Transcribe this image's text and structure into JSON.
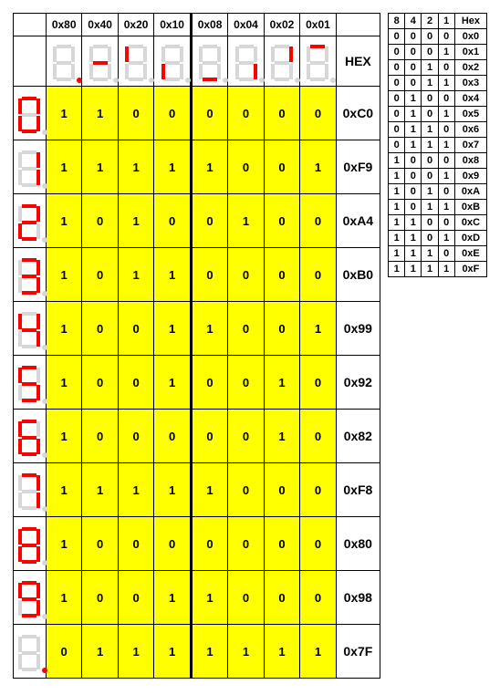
{
  "main": {
    "col_headers": [
      "0x80",
      "0x40",
      "0x20",
      "0x10",
      "0x08",
      "0x04",
      "0x02",
      "0x01"
    ],
    "hex_label": "HEX",
    "seg_order": [
      "dp",
      "g",
      "f",
      "e",
      "d",
      "c",
      "b",
      "a"
    ],
    "header_icons": [
      [
        "dp"
      ],
      [
        "g"
      ],
      [
        "f"
      ],
      [
        "e"
      ],
      [
        "d"
      ],
      [
        "c"
      ],
      [
        "b"
      ],
      [
        "a"
      ]
    ],
    "rows": [
      {
        "icon": [
          "a",
          "b",
          "c",
          "d",
          "e",
          "f"
        ],
        "bits": [
          "1",
          "1",
          "0",
          "0",
          "0",
          "0",
          "0",
          "0"
        ],
        "hex": "0xC0"
      },
      {
        "icon": [
          "b",
          "c"
        ],
        "bits": [
          "1",
          "1",
          "1",
          "1",
          "1",
          "0",
          "0",
          "1"
        ],
        "hex": "0xF9"
      },
      {
        "icon": [
          "a",
          "b",
          "d",
          "e",
          "g"
        ],
        "bits": [
          "1",
          "0",
          "1",
          "0",
          "0",
          "1",
          "0",
          "0"
        ],
        "hex": "0xA4"
      },
      {
        "icon": [
          "a",
          "b",
          "c",
          "d",
          "g"
        ],
        "bits": [
          "1",
          "0",
          "1",
          "1",
          "0",
          "0",
          "0",
          "0"
        ],
        "hex": "0xB0"
      },
      {
        "icon": [
          "b",
          "c",
          "f",
          "g"
        ],
        "bits": [
          "1",
          "0",
          "0",
          "1",
          "1",
          "0",
          "0",
          "1"
        ],
        "hex": "0x99"
      },
      {
        "icon": [
          "a",
          "c",
          "d",
          "f",
          "g"
        ],
        "bits": [
          "1",
          "0",
          "0",
          "1",
          "0",
          "0",
          "1",
          "0"
        ],
        "hex": "0x92"
      },
      {
        "icon": [
          "a",
          "c",
          "d",
          "e",
          "f",
          "g"
        ],
        "bits": [
          "1",
          "0",
          "0",
          "0",
          "0",
          "0",
          "1",
          "0"
        ],
        "hex": "0x82"
      },
      {
        "icon": [
          "a",
          "b",
          "c"
        ],
        "bits": [
          "1",
          "1",
          "1",
          "1",
          "1",
          "0",
          "0",
          "0"
        ],
        "hex": "0xF8"
      },
      {
        "icon": [
          "a",
          "b",
          "c",
          "d",
          "e",
          "f",
          "g"
        ],
        "bits": [
          "1",
          "0",
          "0",
          "0",
          "0",
          "0",
          "0",
          "0"
        ],
        "hex": "0x80"
      },
      {
        "icon": [
          "a",
          "b",
          "c",
          "d",
          "f",
          "g"
        ],
        "bits": [
          "1",
          "0",
          "0",
          "1",
          "1",
          "0",
          "0",
          "0"
        ],
        "hex": "0x98"
      },
      {
        "icon": [
          "dp"
        ],
        "bits": [
          "0",
          "1",
          "1",
          "1",
          "1",
          "1",
          "1",
          "1"
        ],
        "hex": "0x7F"
      }
    ]
  },
  "side": {
    "headers": [
      "8",
      "4",
      "2",
      "1",
      "Hex"
    ],
    "rows": [
      [
        "0",
        "0",
        "0",
        "0",
        "0x0"
      ],
      [
        "0",
        "0",
        "0",
        "1",
        "0x1"
      ],
      [
        "0",
        "0",
        "1",
        "0",
        "0x2"
      ],
      [
        "0",
        "0",
        "1",
        "1",
        "0x3"
      ],
      [
        "0",
        "1",
        "0",
        "0",
        "0x4"
      ],
      [
        "0",
        "1",
        "0",
        "1",
        "0x5"
      ],
      [
        "0",
        "1",
        "1",
        "0",
        "0x6"
      ],
      [
        "0",
        "1",
        "1",
        "1",
        "0x7"
      ],
      [
        "1",
        "0",
        "0",
        "0",
        "0x8"
      ],
      [
        "1",
        "0",
        "0",
        "1",
        "0x9"
      ],
      [
        "1",
        "0",
        "1",
        "0",
        "0xA"
      ],
      [
        "1",
        "0",
        "1",
        "1",
        "0xB"
      ],
      [
        "1",
        "1",
        "0",
        "0",
        "0xC"
      ],
      [
        "1",
        "1",
        "0",
        "1",
        "0xD"
      ],
      [
        "1",
        "1",
        "1",
        "0",
        "0xE"
      ],
      [
        "1",
        "1",
        "1",
        "1",
        "0xF"
      ]
    ]
  },
  "chart_data": {
    "type": "table",
    "title": "7-segment common-anode hex encoding",
    "columns": [
      "dp(0x80)",
      "g(0x40)",
      "f(0x20)",
      "e(0x10)",
      "d(0x08)",
      "c(0x04)",
      "b(0x02)",
      "a(0x01)",
      "HEX"
    ],
    "rows": [
      [
        "1",
        "1",
        "0",
        "0",
        "0",
        "0",
        "0",
        "0",
        "0xC0"
      ],
      [
        "1",
        "1",
        "1",
        "1",
        "1",
        "0",
        "0",
        "1",
        "0xF9"
      ],
      [
        "1",
        "0",
        "1",
        "0",
        "0",
        "1",
        "0",
        "0",
        "0xA4"
      ],
      [
        "1",
        "0",
        "1",
        "1",
        "0",
        "0",
        "0",
        "0",
        "0xB0"
      ],
      [
        "1",
        "0",
        "0",
        "1",
        "1",
        "0",
        "0",
        "1",
        "0x99"
      ],
      [
        "1",
        "0",
        "0",
        "1",
        "0",
        "0",
        "1",
        "0",
        "0x92"
      ],
      [
        "1",
        "0",
        "0",
        "0",
        "0",
        "0",
        "1",
        "0",
        "0x82"
      ],
      [
        "1",
        "1",
        "1",
        "1",
        "1",
        "0",
        "0",
        "0",
        "0xF8"
      ],
      [
        "1",
        "0",
        "0",
        "0",
        "0",
        "0",
        "0",
        "0",
        "0x80"
      ],
      [
        "1",
        "0",
        "0",
        "1",
        "1",
        "0",
        "0",
        "0",
        "0x98"
      ],
      [
        "0",
        "1",
        "1",
        "1",
        "1",
        "1",
        "1",
        "1",
        "0x7F"
      ]
    ],
    "side_table": {
      "columns": [
        "8",
        "4",
        "2",
        "1",
        "Hex"
      ],
      "rows": [
        [
          "0",
          "0",
          "0",
          "0",
          "0x0"
        ],
        [
          "0",
          "0",
          "0",
          "1",
          "0x1"
        ],
        [
          "0",
          "0",
          "1",
          "0",
          "0x2"
        ],
        [
          "0",
          "0",
          "1",
          "1",
          "0x3"
        ],
        [
          "0",
          "1",
          "0",
          "0",
          "0x4"
        ],
        [
          "0",
          "1",
          "0",
          "1",
          "0x5"
        ],
        [
          "0",
          "1",
          "1",
          "0",
          "0x6"
        ],
        [
          "0",
          "1",
          "1",
          "1",
          "0x7"
        ],
        [
          "1",
          "0",
          "0",
          "0",
          "0x8"
        ],
        [
          "1",
          "0",
          "0",
          "1",
          "0x9"
        ],
        [
          "1",
          "0",
          "1",
          "0",
          "0xA"
        ],
        [
          "1",
          "0",
          "1",
          "1",
          "0xB"
        ],
        [
          "1",
          "1",
          "0",
          "0",
          "0xC"
        ],
        [
          "1",
          "1",
          "0",
          "1",
          "0xD"
        ],
        [
          "1",
          "1",
          "1",
          "0",
          "0xE"
        ],
        [
          "1",
          "1",
          "1",
          "1",
          "0xF"
        ]
      ]
    }
  }
}
